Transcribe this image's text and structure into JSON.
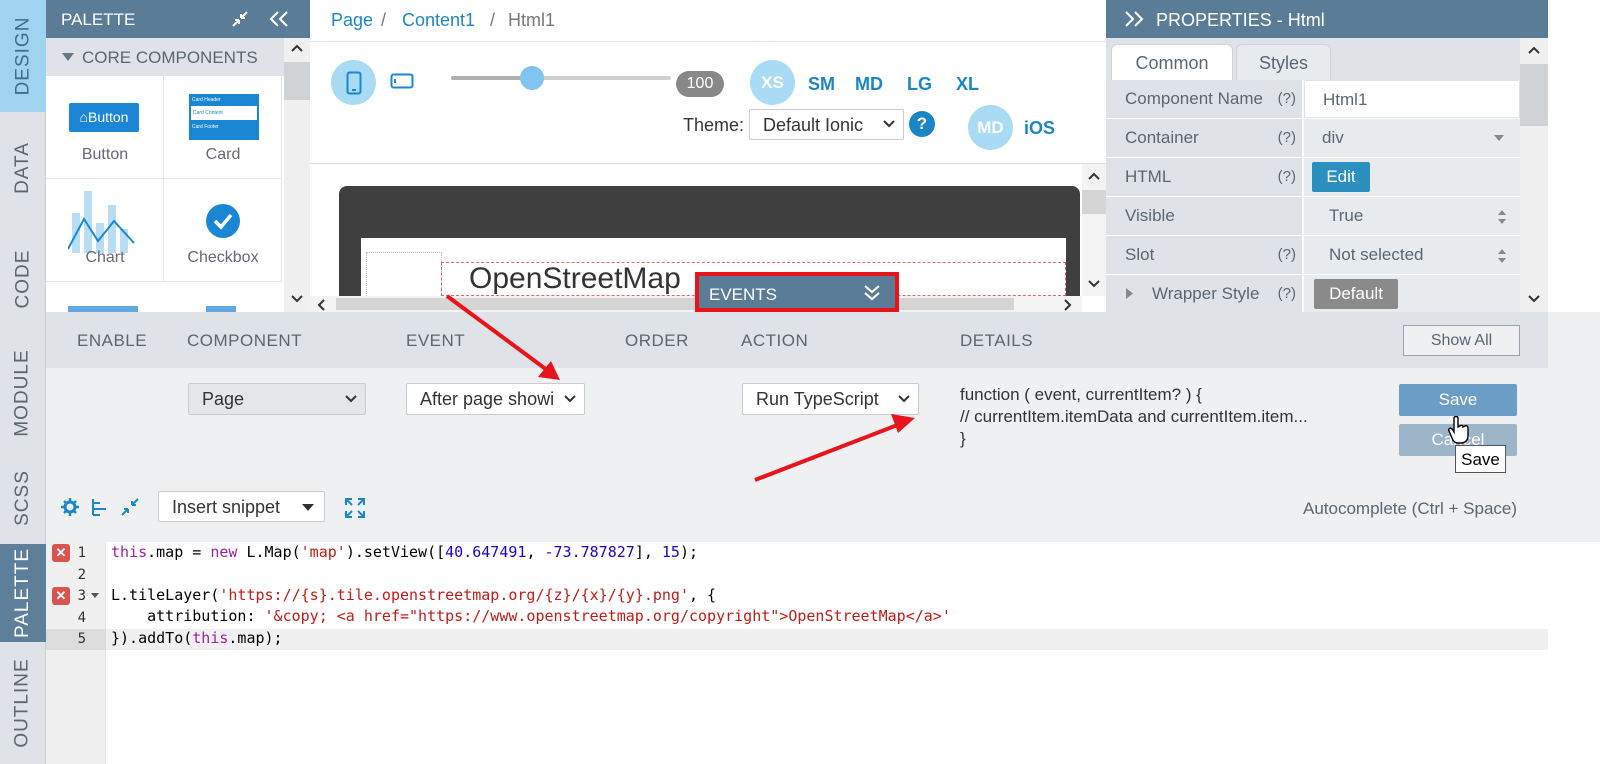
{
  "vertical_tabs": [
    "DESIGN",
    "DATA",
    "CODE",
    "MODULE",
    "SCSS",
    "PALETTE",
    "OUTLINE"
  ],
  "palette": {
    "title": "PALETTE",
    "section": "CORE COMPONENTS",
    "items": [
      {
        "label": "Button",
        "icon_text": "Button"
      },
      {
        "label": "Card",
        "icon_text": "Card Header / Card Content / Card Footer",
        "card_header": "Card Header",
        "card_content": "Card Content",
        "card_footer": "Card Footer"
      },
      {
        "label": "Chart"
      },
      {
        "label": "Checkbox"
      }
    ]
  },
  "breadcrumb": {
    "items": [
      "Page",
      "Content1",
      "Html1"
    ],
    "separator": "/"
  },
  "device": {
    "zoom_value": "100",
    "zoom_fraction": 0.37,
    "sizes": [
      "XS",
      "SM",
      "MD",
      "LG",
      "XL"
    ],
    "active_size": "XS",
    "theme_label": "Theme:",
    "theme_value": "Default Ionic",
    "help": "?",
    "mode_md": "MD",
    "mode_ios": "iOS"
  },
  "preview": {
    "map_text": "OpenStreetMap"
  },
  "properties": {
    "title": "PROPERTIES - Html",
    "tabs": [
      "Common",
      "Styles"
    ],
    "rows": [
      {
        "label": "Component Name",
        "help": "(?)",
        "value": "Html1"
      },
      {
        "label": "Container",
        "help": "(?)",
        "value": "div"
      },
      {
        "label": "HTML",
        "help": "(?)",
        "value": "Edit"
      },
      {
        "label": "Visible",
        "help": "",
        "value": "True"
      },
      {
        "label": "Slot",
        "help": "(?)",
        "value": "Not selected"
      },
      {
        "label": "Wrapper Style",
        "help": "(?)",
        "value": "Default"
      }
    ]
  },
  "events": {
    "title": "EVENTS",
    "columns": [
      "ENABLE",
      "COMPONENT",
      "EVENT",
      "ORDER",
      "ACTION",
      "DETAILS"
    ],
    "show_all": "Show All",
    "row": {
      "component": "Page",
      "event": "After page showi",
      "action": "Run TypeScript",
      "details": [
        "function ( event, currentItem? ) {",
        "// currentItem.itemData and currentItem.item...",
        "}"
      ],
      "save": "Save",
      "cancel": "Cancel"
    },
    "tooltip": "Save"
  },
  "code_toolbar": {
    "snippet": "Insert snippet",
    "autocomplete": "Autocomplete (Ctrl + Space)"
  },
  "code": {
    "line_numbers": [
      "1",
      "2",
      "3",
      "4",
      "5"
    ],
    "error_marker": "✕",
    "lines": [
      "this.map = new L.Map('map').setView([40.647491, -73.787827], 15);",
      "",
      "L.tileLayer('https://{s}.tile.openstreetmap.org/{z}/{x}/{y}.png', {",
      "    attribution: '&copy; <a href=\"https://www.openstreetmap.org/copyright\">OpenStreetMap</a>'",
      "}).addTo(this.map);"
    ]
  },
  "colors": {
    "header": "#5b7c97",
    "accent": "#1b86c5",
    "highlight": "#e8131b",
    "save": "#6b9ec6"
  }
}
